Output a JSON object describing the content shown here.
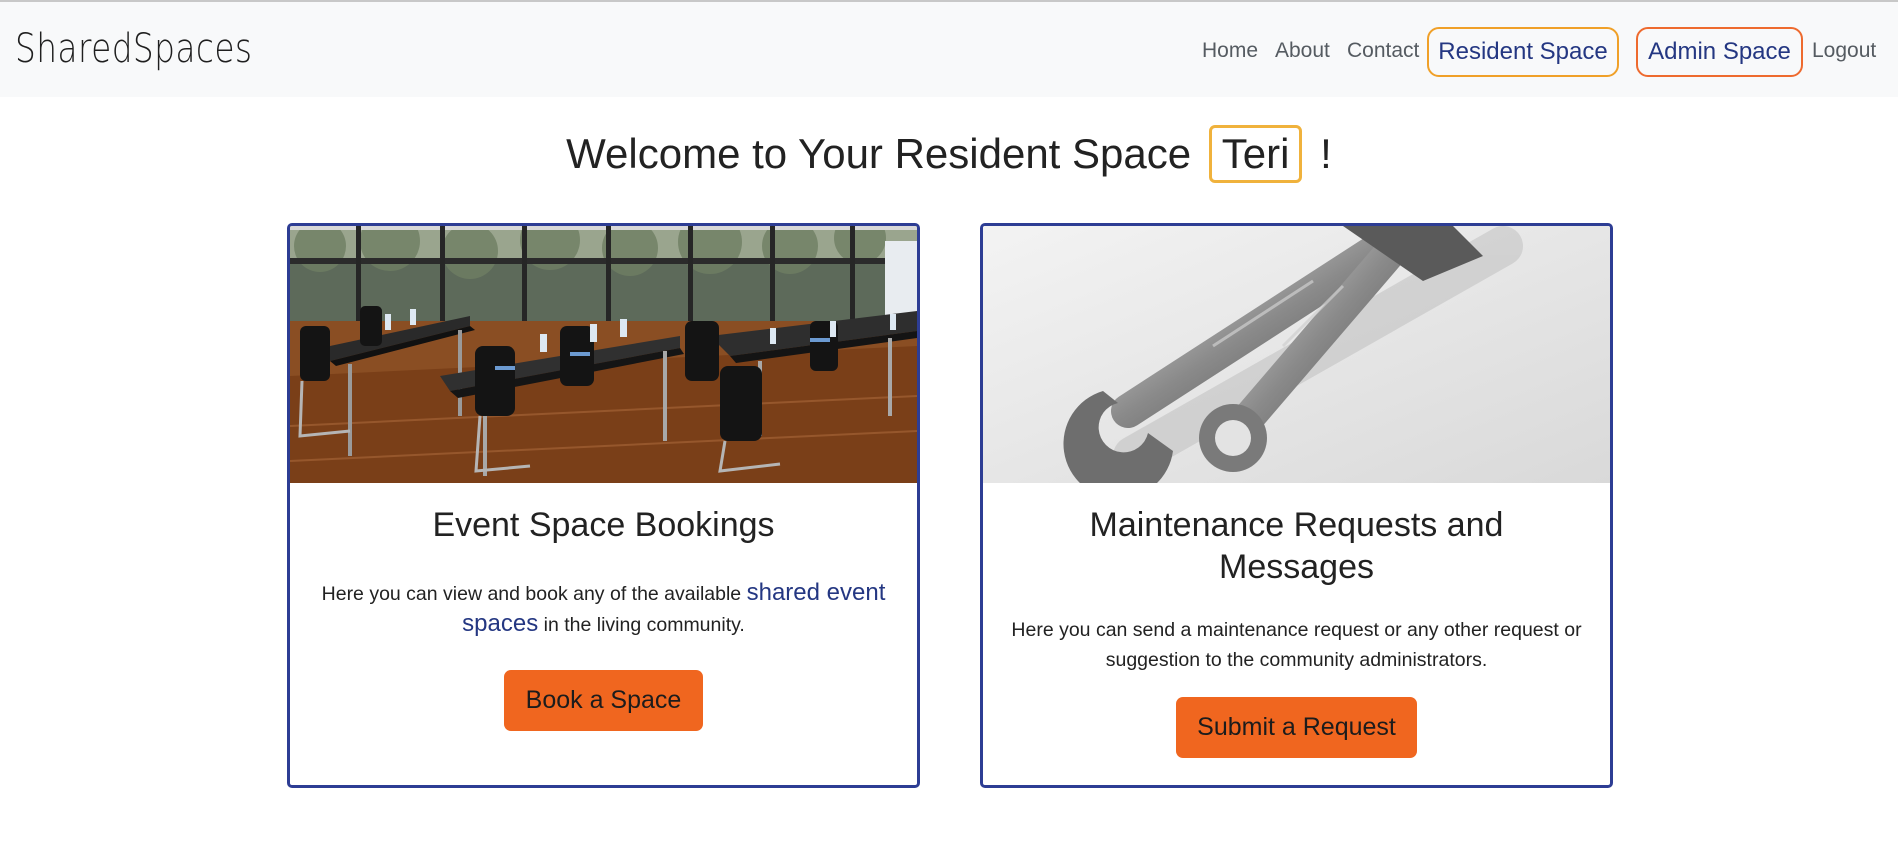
{
  "navbar": {
    "brand": "SharedSpaces",
    "links": {
      "home": "Home",
      "about": "About",
      "contact": "Contact",
      "resident_space": "Resident Space",
      "admin_space": "Admin Space",
      "logout": "Logout"
    }
  },
  "welcome": {
    "prefix": "Welcome to Your Resident Space",
    "name": "Teri",
    "suffix": "!"
  },
  "cards": {
    "events": {
      "title": "Event Space Bookings",
      "text_before": "Here you can view and book any of the available",
      "link": "shared event spaces",
      "text_after": "in the living community.",
      "button": "Book a Space"
    },
    "maintenance": {
      "title_line1": "Maintenance Requests and",
      "title_line2": "Messages",
      "text": "Here you can send a maintenance request or any other request or suggestion to the community administrators.",
      "button": "Submit a Request"
    }
  },
  "colors": {
    "accent_orange": "#f0661f",
    "pill_yellow": "#f0a028",
    "card_border_blue": "#2d3d94",
    "link_blue": "#243782"
  }
}
